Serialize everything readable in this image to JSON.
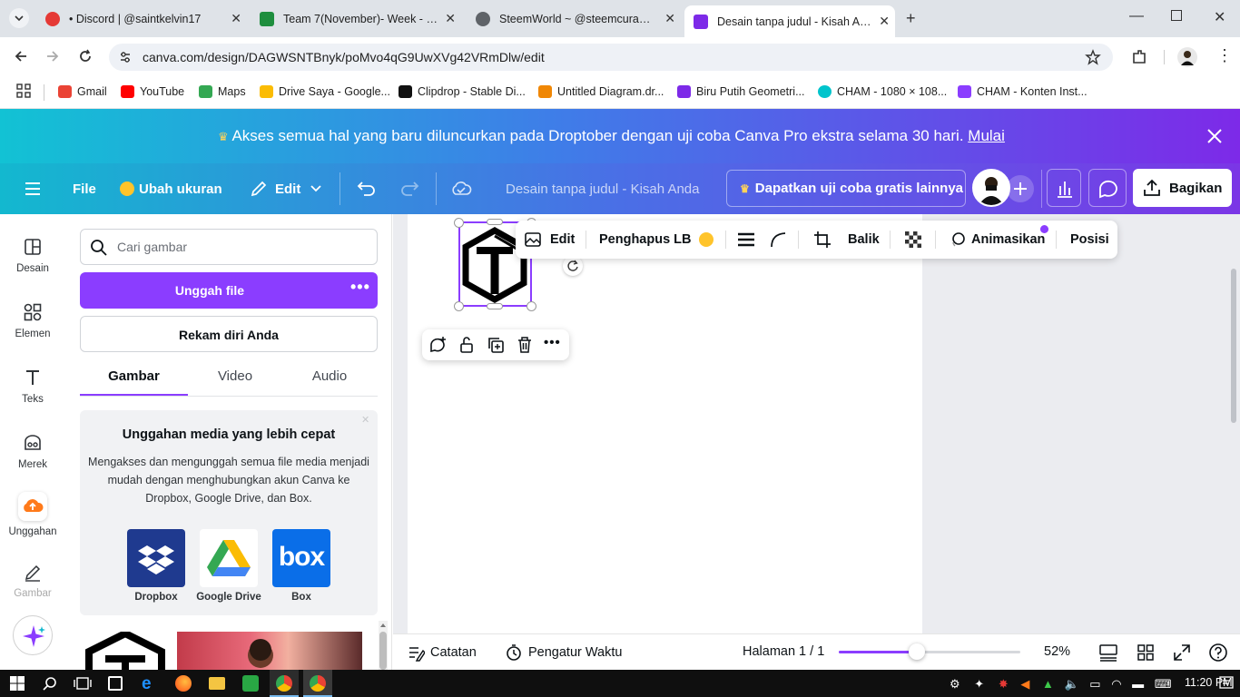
{
  "browser": {
    "tabs": [
      {
        "title": "• Discord | @saintkelvin17",
        "color": "#e53935"
      },
      {
        "title": "Team 7(November)- Week - 2 -",
        "color": "#1e8e3e"
      },
      {
        "title": "SteemWorld ~ @steemcurator0",
        "color": "#5f6368"
      },
      {
        "title": "Desain tanpa judul - Kisah Anda",
        "color": "#7d2ae8"
      }
    ],
    "url": "canva.com/design/DAGWSNTBnyk/poMvo4qG9UwXVg42VRmDlw/edit",
    "bookmarks": [
      {
        "label": "Gmail",
        "color": "#ea4335"
      },
      {
        "label": "YouTube",
        "color": "#ff0000"
      },
      {
        "label": "Maps",
        "color": "#34a853"
      },
      {
        "label": "Drive Saya - Google...",
        "color": "#fbbc04"
      },
      {
        "label": "Clipdrop - Stable Di...",
        "color": "#111111"
      },
      {
        "label": "Untitled Diagram.dr...",
        "color": "#f08705"
      },
      {
        "label": "Biru Putih Geometri...",
        "color": "#7d2ae8"
      },
      {
        "label": "CHAM - 1080 × 108...",
        "color": "#00c4cc"
      },
      {
        "label": "CHAM - Konten Inst...",
        "color": "#8b3dff"
      }
    ]
  },
  "banner": {
    "text": "Akses semua hal yang baru diluncurkan pada Droptober dengan uji coba Canva Pro ekstra selama 30 hari.",
    "link": "Mulai"
  },
  "header": {
    "file": "File",
    "resize": "Ubah ukuran",
    "edit": "Edit",
    "doc_title": "Desain tanpa judul - Kisah Anda",
    "trial": "Dapatkan uji coba gratis lainnya",
    "share": "Bagikan"
  },
  "rail": [
    {
      "label": "Desain",
      "icon": "layout-icon"
    },
    {
      "label": "Elemen",
      "icon": "shapes-icon"
    },
    {
      "label": "Teks",
      "icon": "text-icon"
    },
    {
      "label": "Merek",
      "icon": "brand-icon"
    },
    {
      "label": "Unggahan",
      "icon": "upload-cloud-icon"
    },
    {
      "label": "Gambar",
      "icon": "draw-icon"
    }
  ],
  "panel": {
    "search_placeholder": "Cari gambar",
    "upload": "Unggah file",
    "record": "Rekam diri Anda",
    "tabs": [
      "Gambar",
      "Video",
      "Audio"
    ],
    "card_title": "Unggahan media yang lebih cepat",
    "card_body": "Mengakses dan mengunggah semua file media menjadi mudah dengan menghubungkan akun Canva ke Dropbox, Google Drive, dan Box.",
    "services": [
      "Dropbox",
      "Google Drive",
      "Box"
    ]
  },
  "toolbar": {
    "edit": "Edit",
    "bg_remover": "Penghapus LB",
    "flip": "Balik",
    "animate": "Animasikan",
    "position": "Posisi"
  },
  "footer": {
    "notes": "Catatan",
    "timer": "Pengatur Waktu",
    "page": "Halaman 1 / 1",
    "zoom": "52%",
    "zoom_fraction": 0.43
  },
  "taskbar": {
    "time": "11:20 PM"
  },
  "colors": {
    "brand_purple": "#8b3dff",
    "teal": "#13b8cf"
  }
}
